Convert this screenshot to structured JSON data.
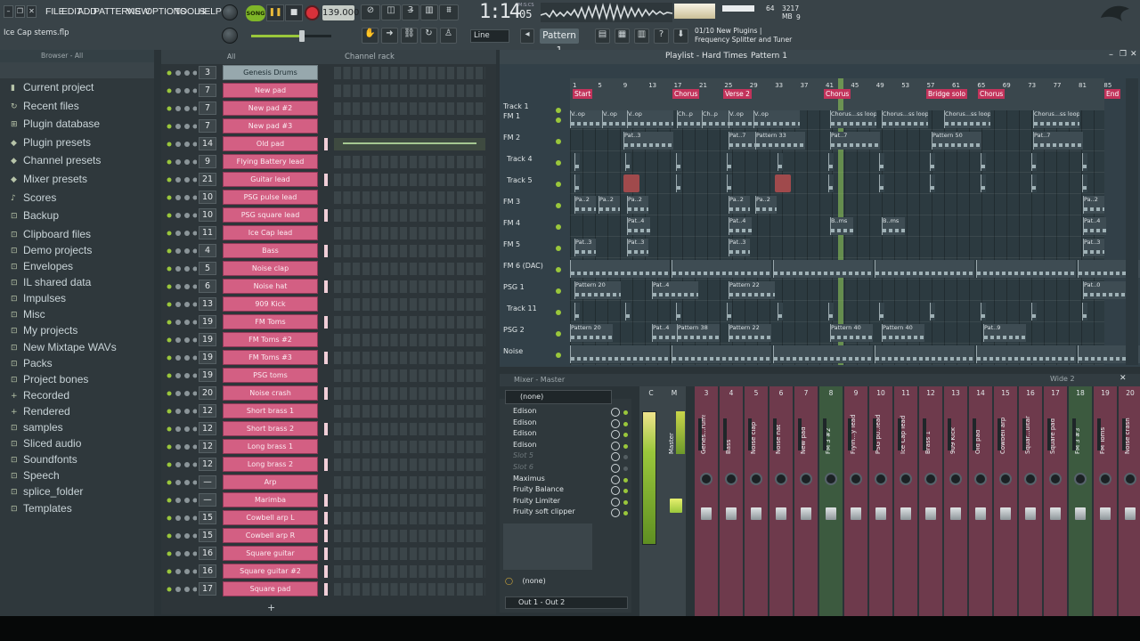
{
  "menu": [
    "FILE",
    "EDIT",
    "ADD",
    "PATTERNS",
    "VIEW",
    "OPTIONS",
    "TOOLS",
    "HELP"
  ],
  "hint_text": "Ice Cap stems.flp",
  "song_label": "SONG",
  "tempo": "139.000",
  "time": {
    "main": "1:14",
    "sub": "05"
  },
  "time_unit": "M:S:CS",
  "cpu": {
    "value": "64",
    "ram": "3217 MB",
    "voices": "9"
  },
  "snap": "Line",
  "pattern_selector": "Pattern 1",
  "news": {
    "count": "01/10",
    "line1": "New Plugins |",
    "line2": "Frequency Splitter and Tuner"
  },
  "browser": {
    "title": "Browser - All",
    "items": [
      "Current project",
      "Recent files",
      "Plugin database",
      "Plugin presets",
      "Channel presets",
      "Mixer presets",
      "Scores",
      "Backup",
      "Clipboard files",
      "Demo projects",
      "Envelopes",
      "IL shared data",
      "Impulses",
      "Misc",
      "My projects",
      "New Mixtape WAVs",
      "Packs",
      "Project bones",
      "Recorded",
      "Rendered",
      "samples",
      "Sliced audio",
      "Soundfonts",
      "Speech",
      "splice_folder",
      "Templates"
    ]
  },
  "channel_rack": {
    "title": "Channel rack",
    "filter": "All",
    "channels": [
      {
        "num": "3",
        "name": "Genesis Drums"
      },
      {
        "num": "7",
        "name": "New pad"
      },
      {
        "num": "7",
        "name": "New pad #2"
      },
      {
        "num": "7",
        "name": "New pad #3"
      },
      {
        "num": "14",
        "name": "Old pad"
      },
      {
        "num": "9",
        "name": "Flying Battery lead"
      },
      {
        "num": "21",
        "name": "Guitar lead"
      },
      {
        "num": "10",
        "name": "PSG pulse lead"
      },
      {
        "num": "10",
        "name": "PSG square lead"
      },
      {
        "num": "11",
        "name": "Ice Cap lead"
      },
      {
        "num": "4",
        "name": "Bass"
      },
      {
        "num": "5",
        "name": "Noise clap"
      },
      {
        "num": "6",
        "name": "Noise hat"
      },
      {
        "num": "13",
        "name": "909 Kick"
      },
      {
        "num": "19",
        "name": "FM Toms"
      },
      {
        "num": "19",
        "name": "FM Toms #2"
      },
      {
        "num": "19",
        "name": "FM Toms #3"
      },
      {
        "num": "19",
        "name": "PSG toms"
      },
      {
        "num": "20",
        "name": "Noise crash"
      },
      {
        "num": "12",
        "name": "Short brass 1"
      },
      {
        "num": "12",
        "name": "Short brass 2"
      },
      {
        "num": "12",
        "name": "Long brass 1"
      },
      {
        "num": "12",
        "name": "Long brass 2"
      },
      {
        "num": "—",
        "name": "Arp"
      },
      {
        "num": "—",
        "name": "Marimba"
      },
      {
        "num": "15",
        "name": "Cowbell arp L"
      },
      {
        "num": "15",
        "name": "Cowbell arp R"
      },
      {
        "num": "16",
        "name": "Square guitar"
      },
      {
        "num": "16",
        "name": "Square guitar #2"
      },
      {
        "num": "17",
        "name": "Square pad"
      }
    ]
  },
  "playlist": {
    "title": "Playlist - Hard Times",
    "pattern": "Pattern 1",
    "bar_numbers": [
      "1",
      "5",
      "9",
      "13",
      "17",
      "21",
      "25",
      "29",
      "33",
      "37",
      "41",
      "45",
      "49",
      "53",
      "57",
      "61",
      "65",
      "69",
      "73",
      "77",
      "81",
      "85"
    ],
    "markers": [
      "Start",
      "Chorus",
      "Verse 2",
      "Chorus",
      "Bridge solo",
      "Chorus",
      "End"
    ],
    "tracks": [
      "Track 1",
      "FM 1",
      "FM 2",
      "Track 4",
      "Track 5",
      "FM 3",
      "FM 4",
      "FM 5",
      "FM 6 (DAC)",
      "PSG 1",
      "Track 11",
      "PSG 2",
      "Noise"
    ],
    "clip_labels": {
      "fm1": [
        "V..op",
        "V..op",
        "V..op",
        "Ch..p",
        "Ch..p",
        "V..op",
        "V..op",
        "Chorus...ss loop",
        "Chorus...ss loop",
        "Chorus...ss loop",
        "Chorus...ss loop"
      ],
      "fm2": [
        "Pat..3",
        "Pat..7",
        "Pattern 33",
        "Pat..7",
        "Pattern 50",
        "Pat..7"
      ],
      "fm3": [
        "Pa..2",
        "Pa..2",
        "Pa..2",
        "Pa..2",
        "Pa..2",
        "Pa..2"
      ],
      "fm4": [
        "Pat..4",
        "Pat..4",
        "B..ms",
        "B..ms",
        "Pat..4"
      ],
      "fm5": [
        "Pat..3",
        "Pat..3",
        "Pat..3",
        "Pat..3"
      ],
      "psg1": [
        "Pattern 20",
        "Pat..4",
        "Pattern 22",
        "Pat..0"
      ],
      "psg2": [
        "Pattern 20",
        "Pat..4",
        "Pattern 38",
        "Pattern 22",
        "Pattern 40",
        "Pattern 40",
        "Pat..9"
      ]
    }
  },
  "mixer": {
    "title": "Mixer - Master",
    "preset": "(none)",
    "slots": [
      {
        "name": "Edison",
        "on": true
      },
      {
        "name": "Edison",
        "on": true
      },
      {
        "name": "Edison",
        "on": true
      },
      {
        "name": "Edison",
        "on": true
      },
      {
        "name": "Slot 5",
        "on": false
      },
      {
        "name": "Slot 6",
        "on": false
      },
      {
        "name": "Maximus",
        "on": true
      },
      {
        "name": "Fruity Balance",
        "on": true
      },
      {
        "name": "Fruity Limiter",
        "on": true
      },
      {
        "name": "Fruity soft clipper",
        "on": true
      }
    ],
    "bottom_preset": "(none)",
    "output": "Out 1 - Out 2",
    "view": "Wide 2",
    "strips": [
      {
        "num": "C",
        "label": "",
        "color": "default"
      },
      {
        "num": "M",
        "label": "Master",
        "color": "default"
      },
      {
        "num": "3",
        "label": "Genes...rums",
        "color": "pink"
      },
      {
        "num": "4",
        "label": "Bass",
        "color": "pink"
      },
      {
        "num": "5",
        "label": "Noise clap",
        "color": "pink"
      },
      {
        "num": "6",
        "label": "Noise hat",
        "color": "pink"
      },
      {
        "num": "7",
        "label": "New pad",
        "color": "pink"
      },
      {
        "num": "8",
        "label": "FM 3 #2",
        "color": "green"
      },
      {
        "num": "9",
        "label": "Flyin...y lead",
        "color": "pink"
      },
      {
        "num": "10",
        "label": "PSG pu..lead",
        "color": "pink"
      },
      {
        "num": "11",
        "label": "Ice Cap lead",
        "color": "pink"
      },
      {
        "num": "12",
        "label": "Brass 1",
        "color": "pink"
      },
      {
        "num": "13",
        "label": "909 Kick",
        "color": "pink"
      },
      {
        "num": "14",
        "label": "Old pad",
        "color": "pink"
      },
      {
        "num": "15",
        "label": "Cowbell arp",
        "color": "pink"
      },
      {
        "num": "16",
        "label": "Squar...uitar",
        "color": "pink"
      },
      {
        "num": "17",
        "label": "Square pad",
        "color": "pink"
      },
      {
        "num": "18",
        "label": "FM 3 #3",
        "color": "green"
      },
      {
        "num": "19",
        "label": "FM Toms",
        "color": "pink"
      },
      {
        "num": "20",
        "label": "Noise crash",
        "color": "pink"
      }
    ]
  },
  "colors": {
    "accent_pink": "#d35f83",
    "accent_green": "#7fb628",
    "panel": "#2a3337"
  }
}
